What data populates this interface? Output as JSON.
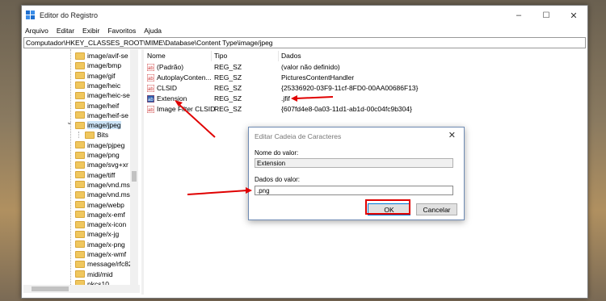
{
  "window": {
    "title": "Editor do Registro",
    "min": "–",
    "max": "☐",
    "close": "✕"
  },
  "menu": [
    "Arquivo",
    "Editar",
    "Exibir",
    "Favoritos",
    "Ajuda"
  ],
  "address": "Computador\\HKEY_CLASSES_ROOT\\MIME\\Database\\Content Type\\image/jpeg",
  "tree": [
    "image/avif-se",
    "image/bmp",
    "image/gif",
    "image/heic",
    "image/heic-se",
    "image/heif",
    "image/heif-se",
    "image/jpeg",
    "Bits",
    "image/pjpeg",
    "image/png",
    "image/svg+xr",
    "image/tiff",
    "image/vnd.ms",
    "image/vnd.ms",
    "image/webp",
    "image/x-emf",
    "image/x-icon",
    "image/x-jg",
    "image/x-png",
    "image/x-wmf",
    "message/rfc82",
    "midi/mid",
    "pkcs10"
  ],
  "columns": {
    "name": "Nome",
    "type": "Tipo",
    "data": "Dados"
  },
  "values": [
    {
      "name": "(Padrão)",
      "type": "REG_SZ",
      "data": "(valor não definido)"
    },
    {
      "name": "AutoplayConten...",
      "type": "REG_SZ",
      "data": "PicturesContentHandler"
    },
    {
      "name": "CLSID",
      "type": "REG_SZ",
      "data": "{25336920-03F9-11cf-8FD0-00AA00686F13}"
    },
    {
      "name": "Extension",
      "type": "REG_SZ",
      "data": ".jfif"
    },
    {
      "name": "Image Filter CLSID",
      "type": "REG_SZ",
      "data": "{607fd4e8-0a03-11d1-ab1d-00c04fc9b304}"
    }
  ],
  "dialog": {
    "title": "Editar Cadeia de Caracteres",
    "close": "✕",
    "name_label": "Nome do valor:",
    "name_value": "Extension",
    "data_label": "Dados do valor:",
    "data_value": ".png",
    "ok": "OK",
    "cancel": "Cancelar"
  },
  "icon_names": {
    "regedit": "regedit-icon",
    "folder": "folder-icon",
    "string": "string-value-icon"
  },
  "colors": {
    "highlight": "#e00000",
    "selection": "#cce4f7",
    "folder": "#f0c75e"
  }
}
